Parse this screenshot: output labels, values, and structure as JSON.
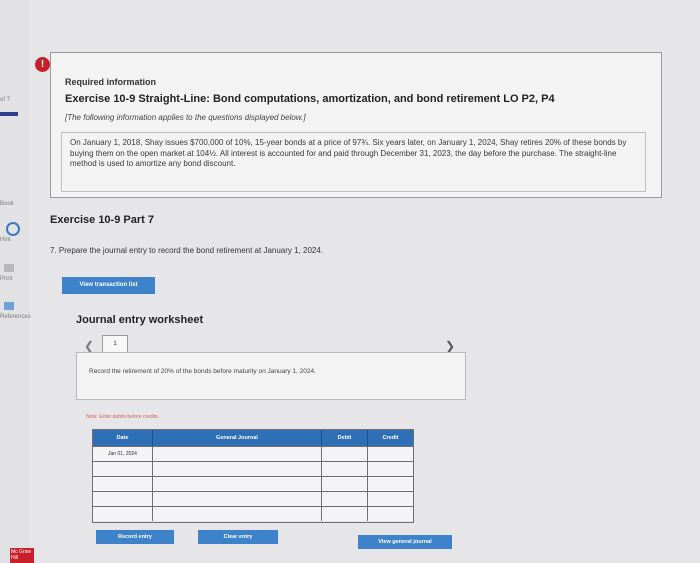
{
  "sidebar": {
    "page_indicator": "of 7",
    "book_label": "Book",
    "hint_label": "Hint",
    "print_label": "Print",
    "references_label": "References",
    "logo_text": "Mc Graw Hill"
  },
  "alert": {
    "icon": "!"
  },
  "info": {
    "heading": "Required information",
    "exercise_title": "Exercise 10-9 Straight-Line: Bond computations, amortization, and bond retirement LO P2, P4",
    "note": "[The following information applies to the questions displayed below.]",
    "body": "On January 1, 2018, Shay issues $700,000 of 10%, 15-year bonds at a price of 97¾. Six years later, on January 1, 2024, Shay retires 20% of these bonds by buying them on the open market at 104½. All interest is accounted for and paid through December 31, 2023, the day before the purchase. The straight-line method is used to amortize any bond discount."
  },
  "part": {
    "title": "Exercise 10-9 Part 7",
    "question": "7. Prepare the journal entry to record the bond retirement at January 1, 2024."
  },
  "buttons": {
    "view_transaction_list": "View transaction list",
    "record_entry": "Record entry",
    "clear_entry": "Clear entry",
    "view_general_journal": "View general journal"
  },
  "worksheet": {
    "title": "Journal entry worksheet",
    "current_page": "1",
    "prev_icon": "chevron-left-icon",
    "next_icon": "chevron-right-icon",
    "instruction": "Record the retirement of 20% of the bonds before maturity on January 1, 2024.",
    "note": "Note: Enter debits before credits.",
    "columns": [
      "Date",
      "General Journal",
      "Debit",
      "Credit"
    ],
    "rows": [
      {
        "date": "Jan 01, 2024",
        "account": "",
        "debit": "",
        "credit": ""
      },
      {
        "date": "",
        "account": "",
        "debit": "",
        "credit": ""
      },
      {
        "date": "",
        "account": "",
        "debit": "",
        "credit": ""
      },
      {
        "date": "",
        "account": "",
        "debit": "",
        "credit": ""
      },
      {
        "date": "",
        "account": "",
        "debit": "",
        "credit": ""
      }
    ]
  },
  "colors": {
    "accent_blue": "#3d82cb",
    "header_blue": "#2f6fb5",
    "alert_red": "#c8202b"
  }
}
